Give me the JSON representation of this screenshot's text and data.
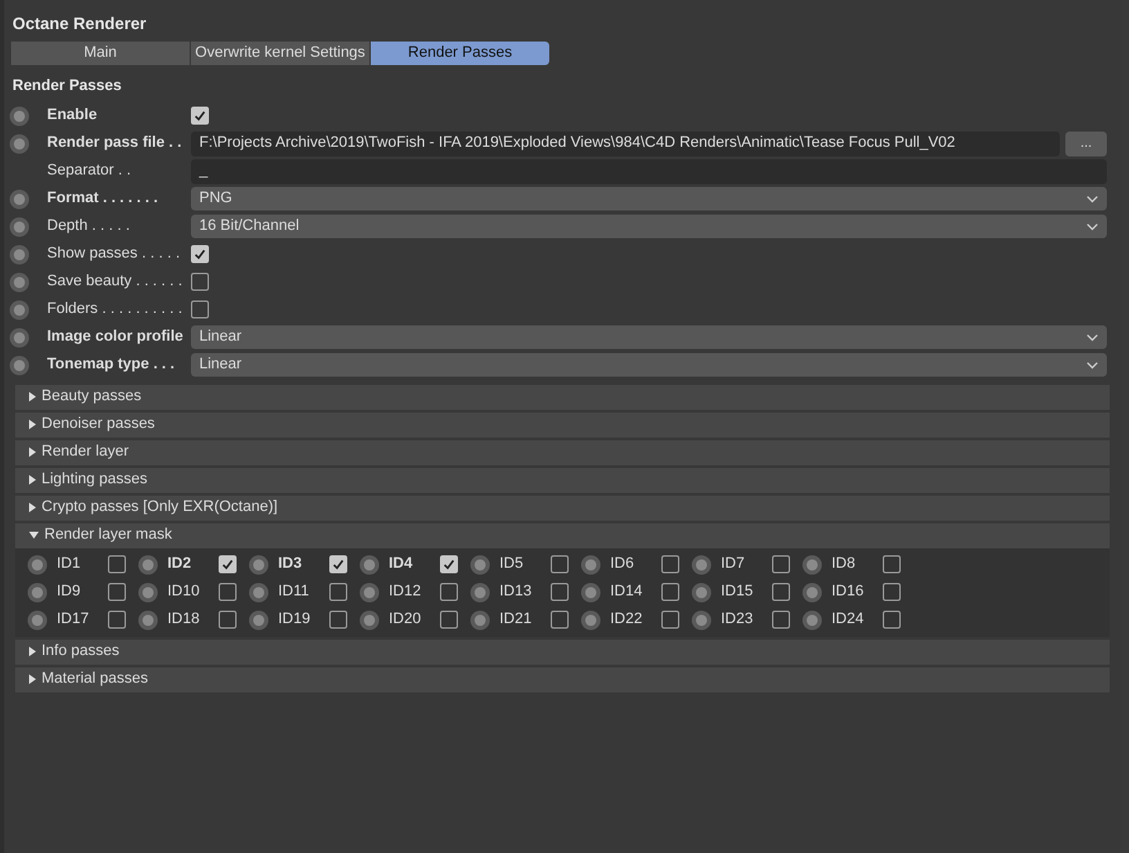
{
  "title": "Octane Renderer",
  "tabs": [
    {
      "label": "Main",
      "selected": false
    },
    {
      "label": "Overwrite kernel Settings",
      "selected": false
    },
    {
      "label": "Render Passes",
      "selected": true
    }
  ],
  "section_title": "Render Passes",
  "fields": [
    {
      "kind": "checkbox",
      "radio": true,
      "label": "Enable",
      "bold": true,
      "checked": true
    },
    {
      "kind": "file",
      "radio": true,
      "label": "Render pass file",
      "dots": " . .",
      "bold": true,
      "value": "F:\\Projects Archive\\2019\\TwoFish - IFA 2019\\Exploded Views\\984\\C4D Renders\\Animatic\\Tease Focus Pull_V02",
      "button": "..."
    },
    {
      "kind": "text",
      "radio": false,
      "label": "Separator",
      "dots": " . .",
      "bold": false,
      "value": "_"
    },
    {
      "kind": "dropdown",
      "radio": true,
      "label": "Format",
      "dots": " . . . . . . .",
      "bold": true,
      "value": "PNG"
    },
    {
      "kind": "dropdown",
      "radio": true,
      "label": "Depth",
      "dots": " . . . . .",
      "bold": false,
      "value": "16 Bit/Channel"
    },
    {
      "kind": "checkbox",
      "radio": true,
      "label": "Show passes",
      "dots": " . . . . .",
      "bold": false,
      "checked": true
    },
    {
      "kind": "checkbox",
      "radio": true,
      "label": "Save beauty",
      "dots": " . . . . . .",
      "bold": false,
      "checked": false
    },
    {
      "kind": "checkbox",
      "radio": true,
      "label": "Folders",
      "dots": " . . . . . . . . . .",
      "bold": false,
      "checked": false
    },
    {
      "kind": "dropdown",
      "radio": true,
      "label": "Image color profile",
      "bold": true,
      "value": "Linear"
    },
    {
      "kind": "dropdown",
      "radio": true,
      "label": "Tonemap type",
      "dots": " . . .",
      "bold": true,
      "value": "Linear"
    }
  ],
  "groups": [
    {
      "label": "Beauty passes",
      "expanded": false
    },
    {
      "label": "Denoiser passes",
      "expanded": false
    },
    {
      "label": "Render layer",
      "expanded": false
    },
    {
      "label": "Lighting passes",
      "expanded": false
    },
    {
      "label": "Crypto passes [Only EXR(Octane)]",
      "expanded": false
    },
    {
      "label": "Render layer mask",
      "expanded": true,
      "ids": [
        {
          "label": "ID1",
          "checked": false
        },
        {
          "label": "ID2",
          "checked": true
        },
        {
          "label": "ID3",
          "checked": true
        },
        {
          "label": "ID4",
          "checked": true
        },
        {
          "label": "ID5",
          "checked": false
        },
        {
          "label": "ID6",
          "checked": false
        },
        {
          "label": "ID7",
          "checked": false
        },
        {
          "label": "ID8",
          "checked": false
        },
        {
          "label": "ID9",
          "checked": false
        },
        {
          "label": "ID10",
          "checked": false
        },
        {
          "label": "ID11",
          "checked": false
        },
        {
          "label": "ID12",
          "checked": false
        },
        {
          "label": "ID13",
          "checked": false
        },
        {
          "label": "ID14",
          "checked": false
        },
        {
          "label": "ID15",
          "checked": false
        },
        {
          "label": "ID16",
          "checked": false
        },
        {
          "label": "ID17",
          "checked": false
        },
        {
          "label": "ID18",
          "checked": false
        },
        {
          "label": "ID19",
          "checked": false
        },
        {
          "label": "ID20",
          "checked": false
        },
        {
          "label": "ID21",
          "checked": false
        },
        {
          "label": "ID22",
          "checked": false
        },
        {
          "label": "ID23",
          "checked": false
        },
        {
          "label": "ID24",
          "checked": false
        }
      ]
    },
    {
      "label": "Info passes",
      "expanded": false
    },
    {
      "label": "Material passes",
      "expanded": false
    }
  ]
}
